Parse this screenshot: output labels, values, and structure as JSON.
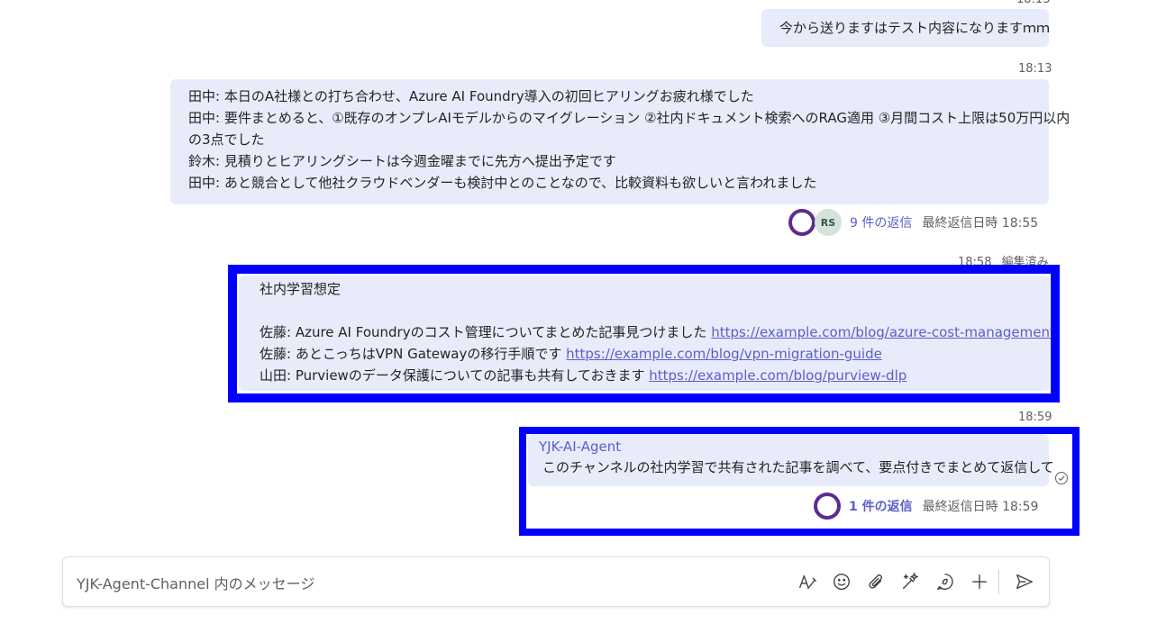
{
  "messages": [
    {
      "time": "18:13",
      "lines": [
        "今から送りますはテスト内容になりますｍｍ"
      ]
    },
    {
      "time": "18:13",
      "lines": [
        "田中: 本日のA社様との打ち合わせ、Azure AI Foundry導入の初回ヒアリングお疲れ様でした",
        "田中: 要件まとめると、①既存のオンプレAIモデルからのマイグレーション ②社内ドキュメント検索へのRAG適用 ③月間コスト上限は50万円以内",
        "の3点でした",
        "鈴木: 見積りとヒアリングシートは今週金曜までに先方へ提出予定です",
        "田中: あと競合として他社クラウドベンダーも検討中とのことなので、比較資料も欲しいと言われました"
      ],
      "thread": {
        "avatar_initials": "RS",
        "reply_count": "9 件の返信",
        "last_reply": "最終返信日時 18:55"
      }
    },
    {
      "time": "18:58",
      "edited": "編集済み",
      "heading": "社内学習想定",
      "link_lines": [
        {
          "text": "佐藤: Azure AI Foundryのコスト管理についてまとめた記事見つけました",
          "url": "https://example.com/blog/azure-cost-management"
        },
        {
          "text": "佐藤: あとこっちはVPN Gatewayの移行手順です",
          "url": "https://example.com/blog/vpn-migration-guide"
        },
        {
          "text": "山田: Purviewのデータ保護についての記事も共有しておきます",
          "url": "https://example.com/blog/purview-dlp"
        }
      ]
    },
    {
      "time": "18:59",
      "sender": "YJK-AI-Agent",
      "text": "このチャンネルの社内学習で共有された記事を調べて、要点付きでまとめて返信して",
      "thread": {
        "reply_count": "1 件の返信",
        "last_reply": "最終返信日時 18:59"
      }
    }
  ],
  "composer": {
    "placeholder": "YJK-Agent-Channel 内のメッセージ"
  },
  "toolbar_icons": [
    "format-icon",
    "emoji-icon",
    "attach-icon",
    "copilot-icon",
    "loop-icon",
    "plus-icon",
    "send-icon"
  ],
  "colors": {
    "bubble": "#e8ebfa",
    "accent": "#5b5fc7",
    "highlight": "#0000ff"
  }
}
